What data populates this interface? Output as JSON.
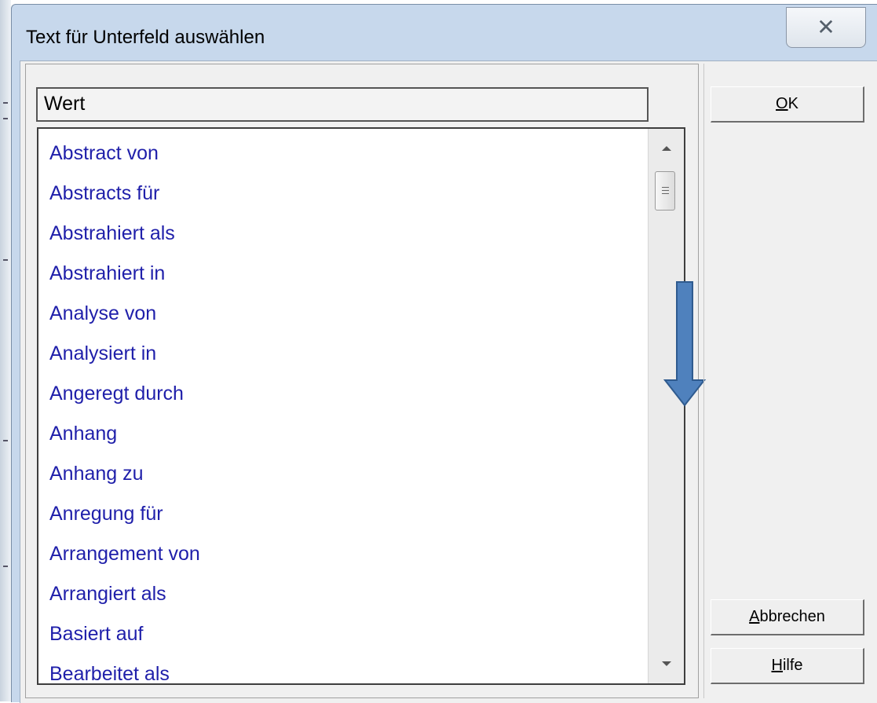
{
  "dialog": {
    "title": "Text für Unterfeld auswählen",
    "close_glyph": "✕"
  },
  "list": {
    "header": "Wert",
    "items": [
      "Abstract von",
      "Abstracts für",
      "Abstrahiert als",
      "Abstrahiert in",
      "Analyse von",
      "Analysiert in",
      "Angeregt durch",
      "Anhang",
      "Anhang zu",
      "Anregung für",
      "Arrangement von",
      "Arrangiert als",
      "Basiert auf",
      "Bearbeitet als"
    ],
    "scrollbar_icons": [
      "scroll-up-icon",
      "scroll-thumb-icon",
      "scroll-down-icon"
    ],
    "annotation_icon": "down-arrow-icon",
    "annotation_color": "#4f81bd",
    "item_color": "#1f1faa"
  },
  "buttons": {
    "ok": {
      "mnemonic": "O",
      "rest": "K"
    },
    "cancel": {
      "mnemonic": "A",
      "rest": "bbrechen"
    },
    "help": {
      "mnemonic": "H",
      "rest": "ilfe"
    }
  }
}
